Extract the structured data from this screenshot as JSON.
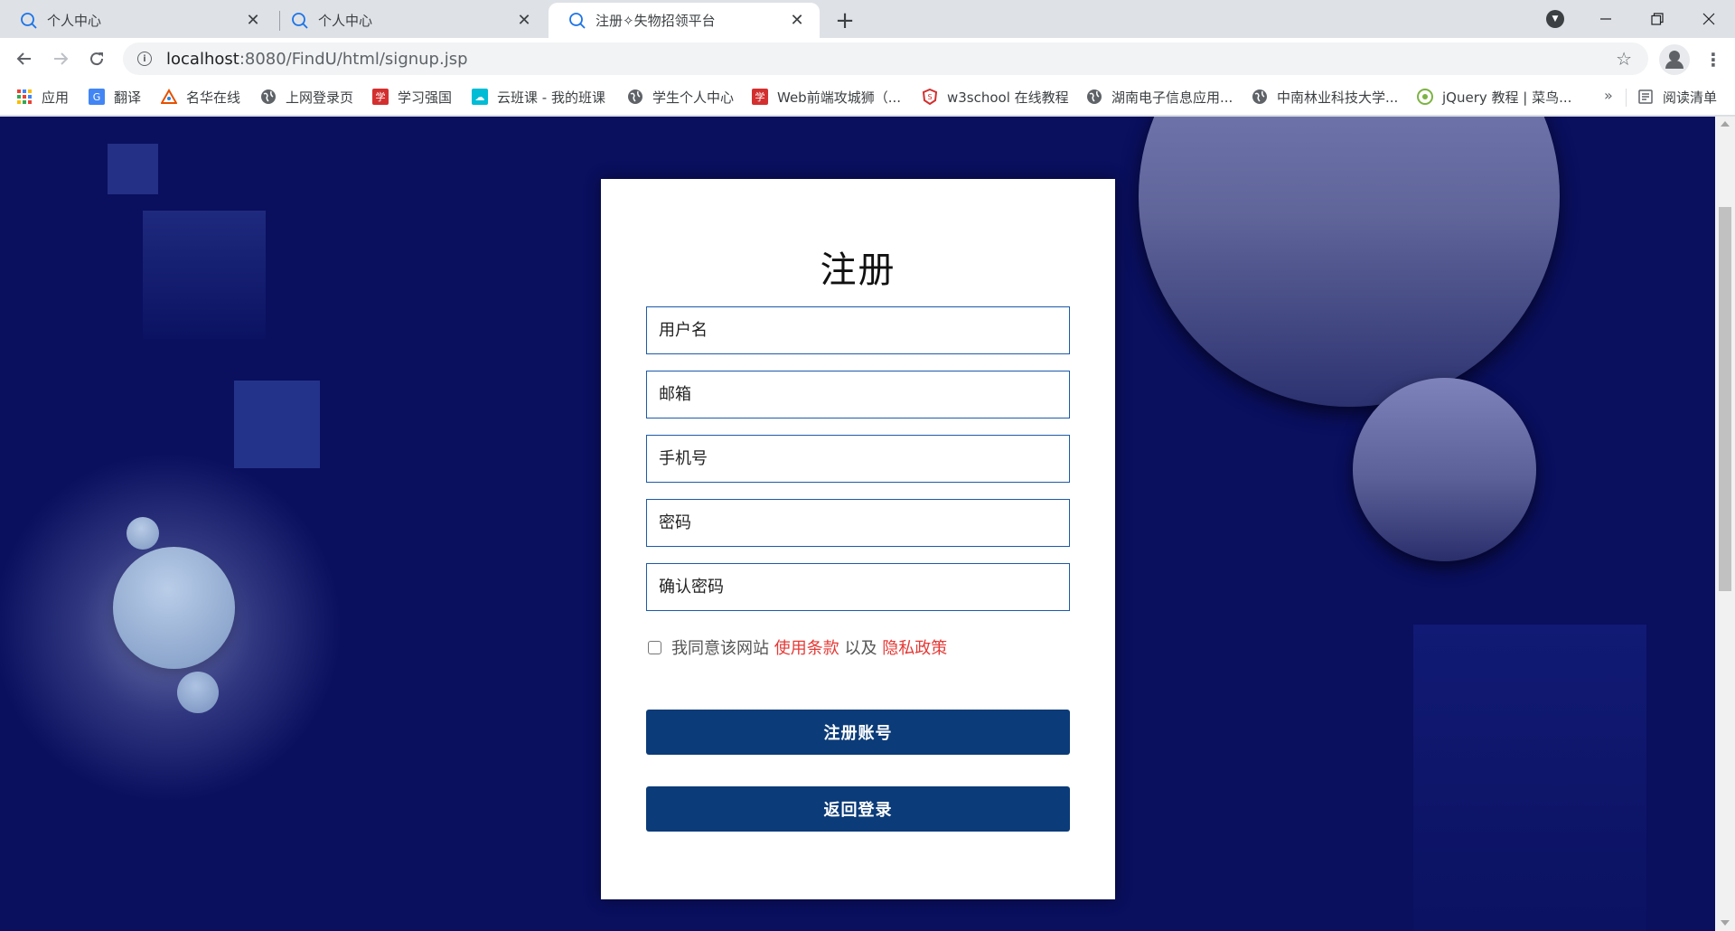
{
  "tabs": [
    {
      "title": "个人中心",
      "active": false
    },
    {
      "title": "个人中心",
      "active": false
    },
    {
      "title": "注册✧失物招领平台",
      "active": true
    }
  ],
  "toolbar": {
    "url_host": "localhost",
    "url_path": ":8080/FindU/html/signup.jsp"
  },
  "bookmarks": [
    {
      "label": "应用",
      "icon": "apps-grid-icon"
    },
    {
      "label": "翻译",
      "icon": "translate-icon"
    },
    {
      "label": "名华在线",
      "icon": "triangle-logo-icon"
    },
    {
      "label": "上网登录页",
      "icon": "globe-icon"
    },
    {
      "label": "学习强国",
      "icon": "xuexi-icon"
    },
    {
      "label": "云班课 - 我的班课",
      "icon": "cloud-icon"
    },
    {
      "label": "学生个人中心",
      "icon": "globe-icon"
    },
    {
      "label": "Web前端攻城狮（...",
      "icon": "xuexi-icon"
    },
    {
      "label": "w3school 在线教程",
      "icon": "w3school-icon"
    },
    {
      "label": "湖南电子信息应用...",
      "icon": "globe-icon"
    },
    {
      "label": "中南林业科技大学...",
      "icon": "globe-icon"
    },
    {
      "label": "jQuery 教程 | 菜鸟...",
      "icon": "runoob-icon"
    }
  ],
  "reading_list": "阅读清单",
  "form": {
    "title": "注册",
    "username_placeholder": "用户名",
    "email_placeholder": "邮箱",
    "phone_placeholder": "手机号",
    "password_placeholder": "密码",
    "confirm_placeholder": "确认密码",
    "agree_prefix": "我同意该网站",
    "terms_link": "使用条款",
    "agree_mid": "以及",
    "privacy_link": "隐私政策",
    "register_button": "注册账号",
    "back_button": "返回登录"
  },
  "colors": {
    "page_bg": "#0a0f5e",
    "button_bg": "#0b3b78",
    "link": "#e53935",
    "field_border": "#1c5aa8"
  }
}
